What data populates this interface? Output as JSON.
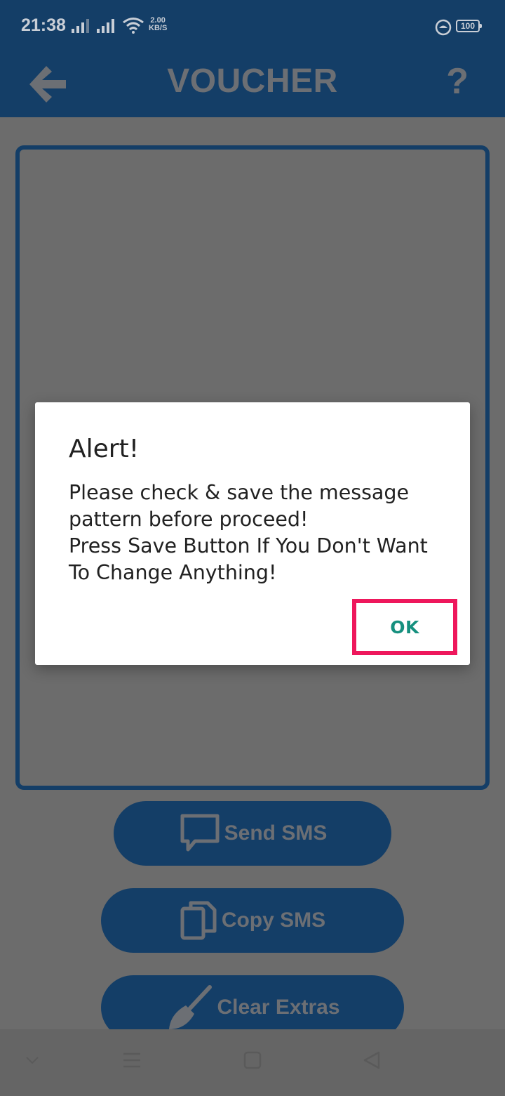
{
  "status_bar": {
    "time": "21:38",
    "net_speed_value": "2.00",
    "net_speed_unit": "KB/S",
    "battery": "100"
  },
  "app_bar": {
    "title": "VOUCHER",
    "help": "?"
  },
  "buttons": {
    "send_sms": "Send SMS",
    "copy_sms": "Copy SMS",
    "clear_extras": "Clear Extras"
  },
  "dialog": {
    "title": "Alert!",
    "message_lines": [
      "Please check & save the message",
      "pattern before proceed!",
      "Press Save Button If You Don't Want",
      "To Change Anything!"
    ],
    "ok_label": "OK",
    "highlight_color": "#ee175c",
    "ok_color": "#16907f"
  },
  "colors": {
    "primary": "#143e67",
    "scrim_background": "#6c6c6c"
  }
}
